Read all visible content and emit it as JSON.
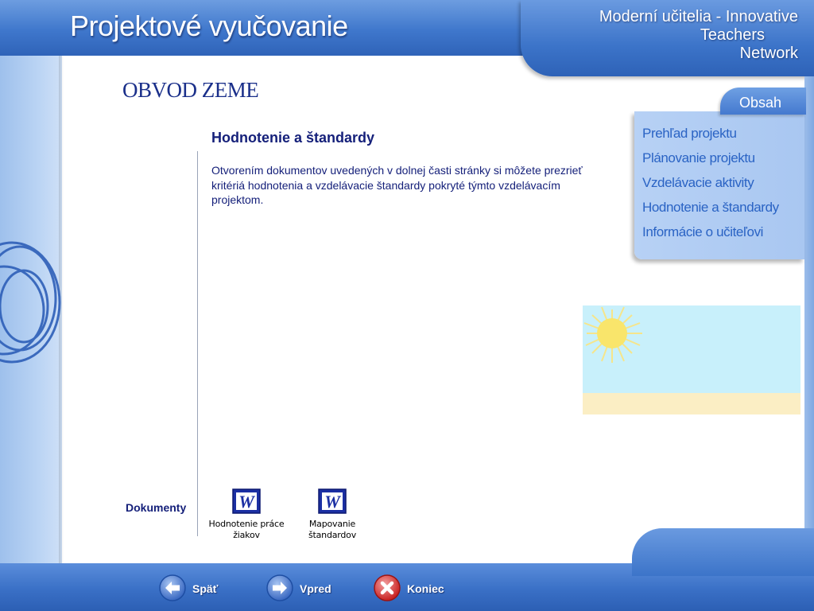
{
  "header": {
    "app_title": "Projektové vyučovanie",
    "network_line1": "Moderní učitelia - Innovative",
    "network_line2": "Teachers",
    "network_line3": "Network"
  },
  "page": {
    "title": "OBVOD ZEME",
    "section_title": "Hodnotenie a štandardy",
    "section_body": "Otvorením dokumentov uvedených v dolnej časti stránky si môžete prezrieť kritériá hodnotenia a vzdelávacie štandardy pokryté týmto vzdelávacím projektom."
  },
  "documents": {
    "label": "Dokumenty",
    "items": [
      {
        "line1": "Hodnotenie práce",
        "line2": "žiakov",
        "icon": "word-document-icon"
      },
      {
        "line1": "Mapovanie",
        "line2": "štandardov",
        "icon": "word-document-icon"
      }
    ]
  },
  "sidebar": {
    "tab_label": "Obsah",
    "items": [
      {
        "label": "Prehľad projektu"
      },
      {
        "label": "Plánovanie projektu"
      },
      {
        "label": "Vzdelávacie aktivity"
      },
      {
        "label": "Hodnotenie a štandardy"
      },
      {
        "label": "Informácie o učiteľovi"
      }
    ]
  },
  "footer": {
    "back_label": "Späť",
    "forward_label": "Vpred",
    "exit_label": "Koniec"
  },
  "colors": {
    "frame_blue": "#3f77cc",
    "text_navy": "#15207a",
    "link_blue": "#2a63c4",
    "exit_red": "#d42a2a"
  }
}
